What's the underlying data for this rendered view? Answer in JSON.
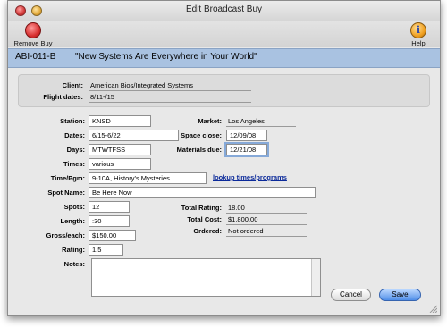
{
  "window": {
    "title": "Edit Broadcast Buy"
  },
  "toolbar": {
    "remove_label": "Remove Buy",
    "help_label": "Help",
    "help_glyph": "i"
  },
  "banner": {
    "code": "ABI-011-B",
    "title": "\"New Systems Are Everywhere in Your World\""
  },
  "info": {
    "client_label": "Client:",
    "client_value": "American Bios/Integrated Systems",
    "flight_label": "Flight dates:",
    "flight_value": "8/11-/15"
  },
  "form": {
    "station_label": "Station:",
    "station_value": "KNSD",
    "dates_label": "Dates:",
    "dates_value": "6/15-6/22",
    "days_label": "Days:",
    "days_value": "MTWTFSS",
    "times_label": "Times:",
    "times_value": "various",
    "timepgm_label": "Time/Pgm:",
    "timepgm_value": "9-10A, History's Mysteries",
    "lookup_link": "lookup times/programs",
    "spotname_label": "Spot Name:",
    "spotname_value": "Be Here Now",
    "spots_label": "Spots:",
    "spots_value": "12",
    "length_label": "Length:",
    "length_value": ":30",
    "gross_label": "Gross/each:",
    "gross_value": "$150.00",
    "rating_label": "Rating:",
    "rating_value": "1.5",
    "notes_label": "Notes:",
    "market_label": "Market:",
    "market_value": "Los Angeles",
    "spaceclose_label": "Space close:",
    "spaceclose_value": "12/09/08",
    "materials_label": "Materials due:",
    "materials_value": "12/21/08",
    "totalrating_label": "Total Rating:",
    "totalrating_value": "18.00",
    "totalcost_label": "Total Cost:",
    "totalcost_value": "$1,800.00",
    "ordered_label": "Ordered:",
    "ordered_value": "Not ordered"
  },
  "buttons": {
    "cancel": "Cancel",
    "save": "Save"
  },
  "colors": {
    "banner": "#a9c2e1",
    "save_button": "#4f8ee8",
    "link": "#0b2a9a"
  }
}
